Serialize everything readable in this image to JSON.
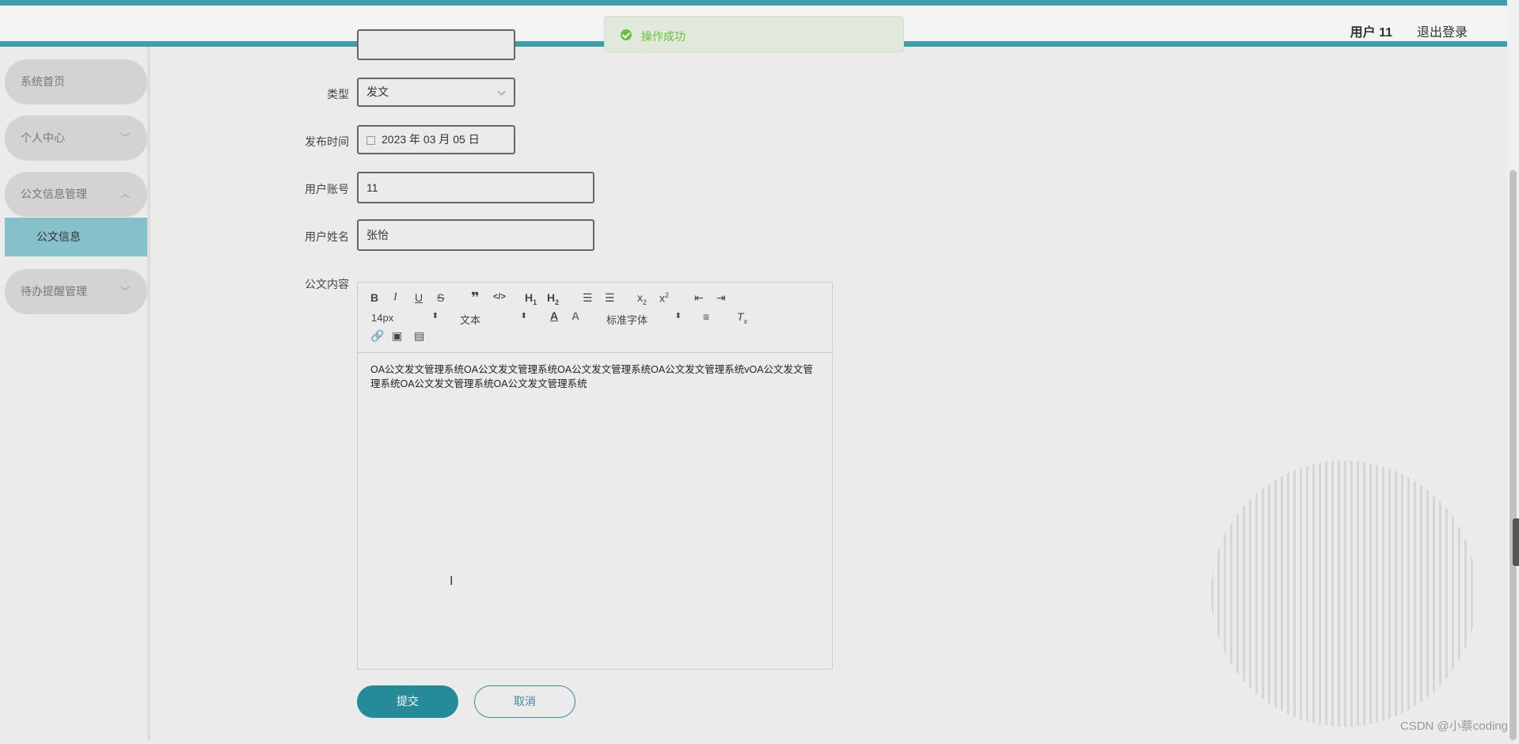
{
  "header": {
    "user_label": "用户 11",
    "logout_label": "退出登录"
  },
  "toast": {
    "message": "操作成功",
    "color": "#67c23a"
  },
  "sidebar": {
    "items": [
      {
        "label": "系统首页"
      },
      {
        "label": "个人中心"
      },
      {
        "label": "公文信息管理"
      },
      {
        "label": "待办提醒管理"
      }
    ],
    "sub_item": "公文信息"
  },
  "form": {
    "type_label": "类型",
    "type_value": "发文",
    "publish_time_label": "发布时间",
    "publish_time_value": "2023 年 03 月 05 日",
    "account_label": "用户账号",
    "account_value": "11",
    "name_label": "用户姓名",
    "name_value": "张怡",
    "content_label": "公文内容",
    "content_value": "OA公文发文管理系统OA公文发文管理系统OA公文发文管理系统OA公文发文管理系统vOA公文发文管理系统OA公文发文管理系统OA公文发文管理系统"
  },
  "editor": {
    "font_size": "14px",
    "format": "文本",
    "font_family": "标准字体"
  },
  "buttons": {
    "submit": "提交",
    "cancel": "取消"
  },
  "watermark": "CSDN @小蔡coding",
  "colors": {
    "accent": "#3c9fa9",
    "primary_button": "#268b98",
    "active_menu": "#86c1cb"
  }
}
